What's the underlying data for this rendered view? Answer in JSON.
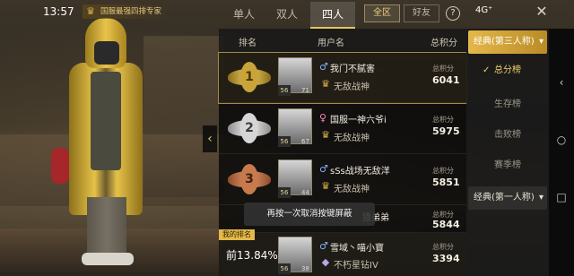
{
  "status": {
    "time": "13:57",
    "network": "4G⁺",
    "banner": "国服最强四排专家"
  },
  "mode_tabs": [
    "单人",
    "双人",
    "四人"
  ],
  "region_tabs": [
    "全区",
    "好友"
  ],
  "table": {
    "headers": {
      "rank": "排名",
      "user": "用户名",
      "score": "总积分"
    }
  },
  "rows": [
    {
      "rank": "1",
      "name": "我门不腻害",
      "gender": "♂",
      "tier": "无敌战神",
      "lv": "56",
      "sub": "71",
      "score_label": "总积分",
      "score": "6041"
    },
    {
      "rank": "2",
      "name": "国服一神六爷i",
      "gender": "♀",
      "tier": "无敌战神",
      "lv": "56",
      "sub": "67",
      "score_label": "总积分",
      "score": "5975"
    },
    {
      "rank": "3",
      "name": "sSs战场无敌洋",
      "gender": "♂",
      "tier": "无敌战神",
      "lv": "56",
      "sub": "44",
      "score_label": "总积分",
      "score": "5851"
    },
    {
      "rank": "4",
      "name": "猎弟弟",
      "score_label": "总积分",
      "score": "5844"
    }
  ],
  "my_row": {
    "tag": "我的排名",
    "percent": "前13.84%",
    "name": "雪域丶喵小寶",
    "gender": "♂",
    "tier": "不朽星钻IV",
    "lv": "56",
    "sub": "38",
    "score_label": "总积分",
    "score": "3394"
  },
  "toast": "再按一次取消按键屏蔽",
  "sidebar": {
    "group1": "经典(第三人称)",
    "items": [
      "总分榜",
      "生存榜",
      "击败榜",
      "赛季榜"
    ],
    "group2": "经典(第一人称)"
  },
  "icons": {
    "check": "✓",
    "expand": "▾",
    "collapse": "‹",
    "close": "✕",
    "help": "?"
  }
}
